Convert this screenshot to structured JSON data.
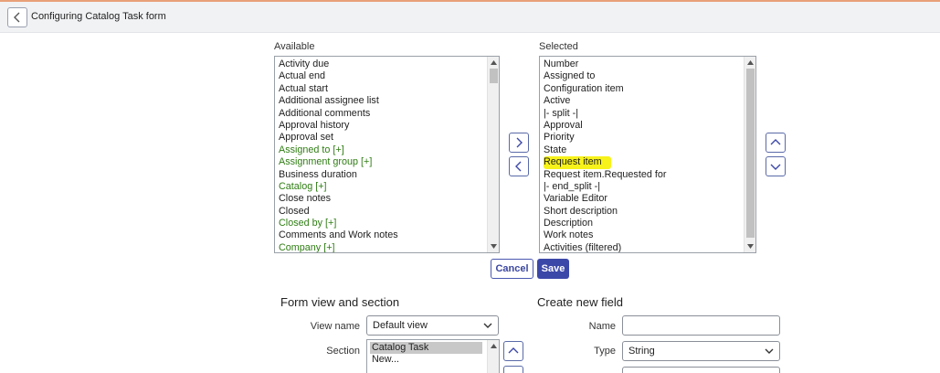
{
  "header": {
    "title": "Configuring Catalog Task form"
  },
  "available": {
    "label": "Available",
    "items": [
      {
        "text": "Activity due",
        "ref": false
      },
      {
        "text": "Actual end",
        "ref": false
      },
      {
        "text": "Actual start",
        "ref": false
      },
      {
        "text": "Additional assignee list",
        "ref": false
      },
      {
        "text": "Additional comments",
        "ref": false
      },
      {
        "text": "Approval history",
        "ref": false
      },
      {
        "text": "Approval set",
        "ref": false
      },
      {
        "text": "Assigned to [+]",
        "ref": true
      },
      {
        "text": "Assignment group [+]",
        "ref": true
      },
      {
        "text": "Business duration",
        "ref": false
      },
      {
        "text": "Catalog [+]",
        "ref": true
      },
      {
        "text": "Close notes",
        "ref": false
      },
      {
        "text": "Closed",
        "ref": false
      },
      {
        "text": "Closed by [+]",
        "ref": true
      },
      {
        "text": "Comments and Work notes",
        "ref": false
      },
      {
        "text": "Company [+]",
        "ref": true
      }
    ]
  },
  "selected": {
    "label": "Selected",
    "items": [
      {
        "text": "Number",
        "highlight": false
      },
      {
        "text": "Assigned to",
        "highlight": false
      },
      {
        "text": "Configuration item",
        "highlight": false
      },
      {
        "text": "Active",
        "highlight": false
      },
      {
        "text": "|- split -|",
        "highlight": false
      },
      {
        "text": "Approval",
        "highlight": false
      },
      {
        "text": "Priority",
        "highlight": false
      },
      {
        "text": "State",
        "highlight": false
      },
      {
        "text": "Request item",
        "highlight": true
      },
      {
        "text": "Request item.Requested for",
        "highlight": false
      },
      {
        "text": "|- end_split -|",
        "highlight": false
      },
      {
        "text": "Variable Editor",
        "highlight": false
      },
      {
        "text": "Short description",
        "highlight": false
      },
      {
        "text": "Description",
        "highlight": false
      },
      {
        "text": "Work notes",
        "highlight": false
      },
      {
        "text": "Activities (filtered)",
        "highlight": false
      }
    ]
  },
  "actions": {
    "cancel": "Cancel",
    "save": "Save"
  },
  "form_view": {
    "title": "Form view and section",
    "view_name_label": "View name",
    "view_name_value": "Default view",
    "section_label": "Section",
    "sections": [
      "Catalog Task",
      "New..."
    ]
  },
  "create_field": {
    "title": "Create new field",
    "name_label": "Name",
    "name_value": "",
    "type_label": "Type",
    "type_value": "String"
  },
  "colors": {
    "accent": "#3c48a8",
    "reference_text": "#2f7d13",
    "highlight": "#f7f21a"
  },
  "icons": {
    "back": "chevron-left-icon",
    "add": "chevron-right-icon",
    "remove": "chevron-left-icon",
    "move_up": "chevron-up-icon",
    "move_down": "chevron-down-icon"
  }
}
